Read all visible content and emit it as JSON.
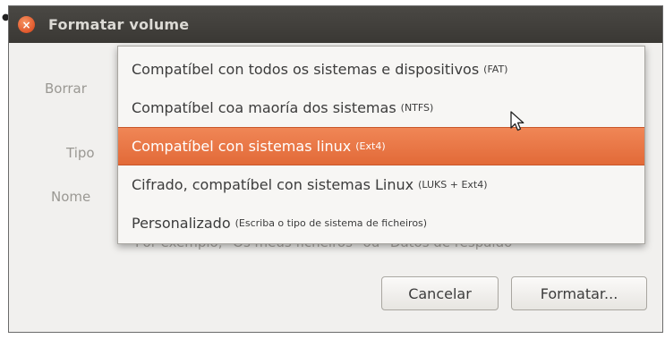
{
  "window": {
    "title": "Formatar volume"
  },
  "form": {
    "erase_label": "Borrar",
    "type_label": "Tipo",
    "name_label": "Nome",
    "name_hint": "Por exemplo, \"Os meus ficheiros\" ou \"Datos de respaldo\""
  },
  "type_dropdown": {
    "options": [
      {
        "label": "Compatíbel con todos os sistemas e dispositivos",
        "detail": "(FAT)"
      },
      {
        "label": "Compatíbel coa maoría dos sistemas",
        "detail": "(NTFS)"
      },
      {
        "label": "Compatíbel con sistemas linux",
        "detail": "(Ext4)"
      },
      {
        "label": "Cifrado, compatíbel con sistemas Linux",
        "detail": "(LUKS + Ext4)"
      },
      {
        "label": "Personalizado",
        "detail": "(Escriba o tipo de sistema de ficheiros)"
      }
    ],
    "highlighted_index": 2
  },
  "buttons": {
    "cancel": "Cancelar",
    "format": "Formatar..."
  },
  "colors": {
    "highlight": "#e97a47",
    "titlebar": "#3f3d39",
    "close": "#e05a2b"
  }
}
